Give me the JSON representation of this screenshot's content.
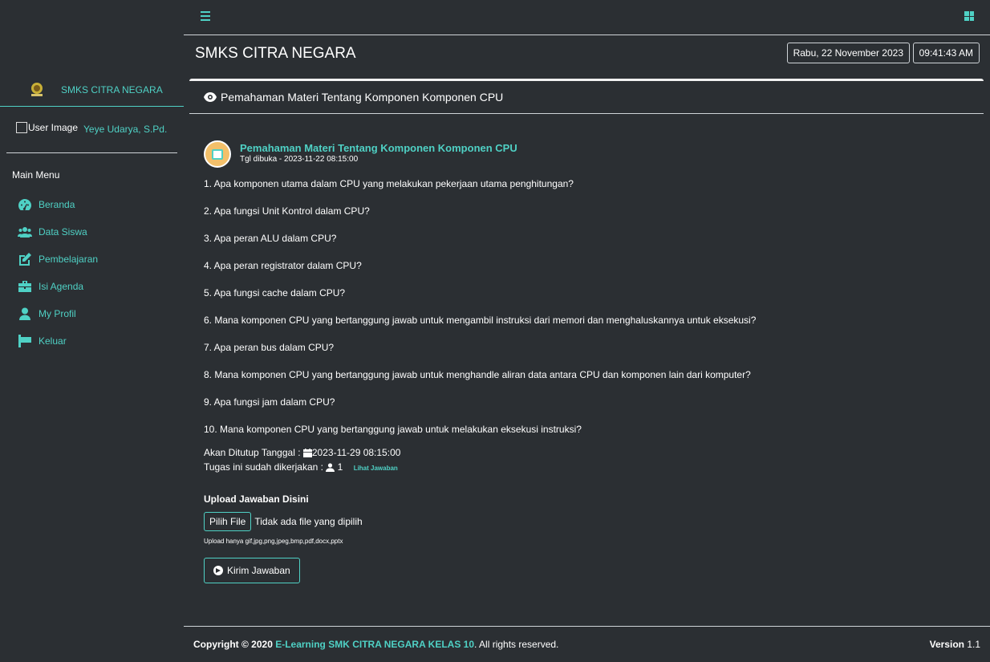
{
  "sidebar": {
    "brand": "SMKS CITRA NEGARA",
    "user_image_alt": "User Image",
    "user_name": "Yeye Udarya, S.Pd.",
    "menu_title": "Main Menu",
    "items": [
      {
        "label": "Beranda",
        "icon": "dashboard-icon"
      },
      {
        "label": "Data Siswa",
        "icon": "users-icon"
      },
      {
        "label": "Pembelajaran",
        "icon": "edit-icon"
      },
      {
        "label": "Isi Agenda",
        "icon": "briefcase-icon"
      },
      {
        "label": "My Profil",
        "icon": "user-icon"
      },
      {
        "label": "Keluar",
        "icon": "sign-out-icon"
      }
    ]
  },
  "header": {
    "title": "SMKS CITRA NEGARA",
    "date": "Rabu, 22 November 2023",
    "time": "09:41:43 AM"
  },
  "card": {
    "header": "Pemahaman Materi Tentang Komponen Komponen CPU",
    "task_title": "Pemahaman Materi Tentang Komponen Komponen CPU",
    "opened": "Tgl dibuka - 2023-11-22 08:15:00",
    "questions": [
      "1. Apa komponen utama dalam CPU yang melakukan pekerjaan utama penghitungan?",
      "2. Apa fungsi Unit Kontrol dalam CPU?",
      "3. Apa peran ALU dalam CPU?",
      "4. Apa peran registrator dalam CPU?",
      "5. Apa fungsi cache dalam CPU?",
      "6. Mana komponen CPU yang bertanggung jawab untuk mengambil instruksi dari memori dan menghaluskannya untuk eksekusi?",
      "7. Apa peran bus dalam CPU?",
      "8. Mana komponen CPU yang bertanggung jawab untuk menghandle aliran data antara CPU dan komponen lain dari komputer?",
      "9. Apa fungsi jam dalam CPU?",
      "10. Mana komponen CPU yang bertanggung jawab untuk melakukan eksekusi instruksi?"
    ],
    "close_label": "Akan Ditutup Tanggal : ",
    "close_date": "2023-11-29 08:15:00",
    "done_label": "Tugas ini sudah dikerjakan : ",
    "done_count": "1",
    "view_answers": "Lihat Jawaban",
    "upload_title": "Upload Jawaban Disini",
    "file_button": "Pilih File",
    "file_status": "Tidak ada file yang dipilih",
    "upload_hint": "Upload hanya gif,jpg,png,jpeg,bmp,pdf,docx,pptx",
    "submit": "Kirim Jawaban"
  },
  "footer": {
    "copyright": "Copyright © 2020 ",
    "link": "E-Learning SMK CITRA NEGARA KELAS 10",
    "rights": ". All rights reserved.",
    "version_label": "Version",
    "version": " 1.1"
  },
  "colors": {
    "background": "#2b2f33",
    "accent": "#4fd1c5",
    "text": "#ffffff"
  }
}
